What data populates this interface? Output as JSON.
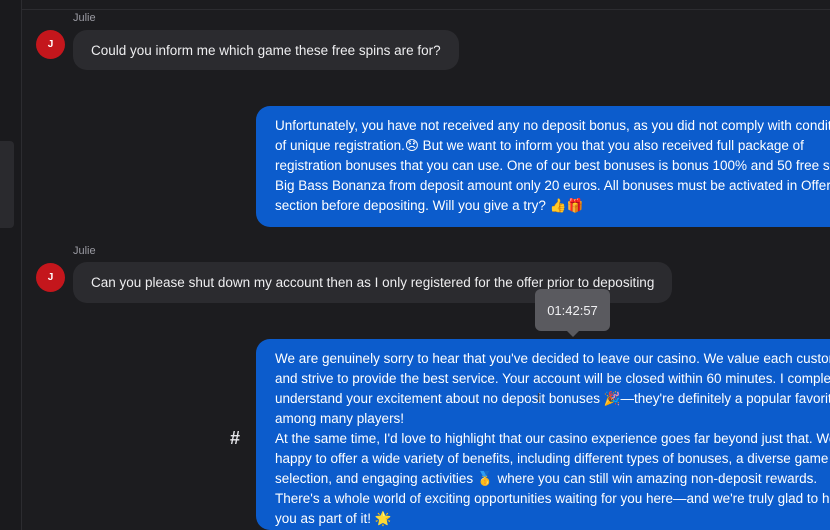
{
  "messages": [
    {
      "sender": "Julie",
      "avatar_initial": "J",
      "text": "Could you inform me which game these free spins are for?"
    },
    {
      "lines": [
        "Unfortunately, you have not received any no deposit bonus, as you did not comply with condit",
        "of unique registration.😞 But we want to inform you that you also received full package of",
        "registration bonuses that you can use. One of our best bonuses is bonus 100% and 50 free sp",
        "Big Bass Bonanza from deposit amount only 20 euros. All bonuses must be activated in Offers",
        "section before depositing. Will you give a try? 👍🎁"
      ]
    },
    {
      "sender": "Julie",
      "avatar_initial": "J",
      "text": "Can you please shut down my account then as I only registered for the offer prior to depositing"
    },
    {
      "tooltip_time": "01:42:57",
      "hash_label": "#",
      "lines": [
        "We are genuinely sorry to hear that you've decided to leave our casino. We value each custom",
        "and strive to provide the best service. Your account will be closed within 60 minutes. I comple",
        "understand your excitement about no deposit bonuses 🎉—they're definitely a popular favorit",
        "among many players!",
        "At the same time, I'd love to highlight that our casino experience goes far beyond just that. We",
        "happy to offer a wide variety of benefits, including different types of bonuses, a diverse game",
        "selection, and engaging activities 🥇 where you can still win amazing non-deposit rewards.",
        "There's a whole world of exciting opportunities waiting for you here—and we're truly glad to h",
        "you as part of it! 🌟"
      ]
    }
  ],
  "colors": {
    "background": "#1c1c1f",
    "incoming_bubble": "#2b2b2f",
    "outgoing_bubble": "#0c5ccc",
    "avatar": "#c4161c",
    "tooltip": "#5a5a5f"
  }
}
